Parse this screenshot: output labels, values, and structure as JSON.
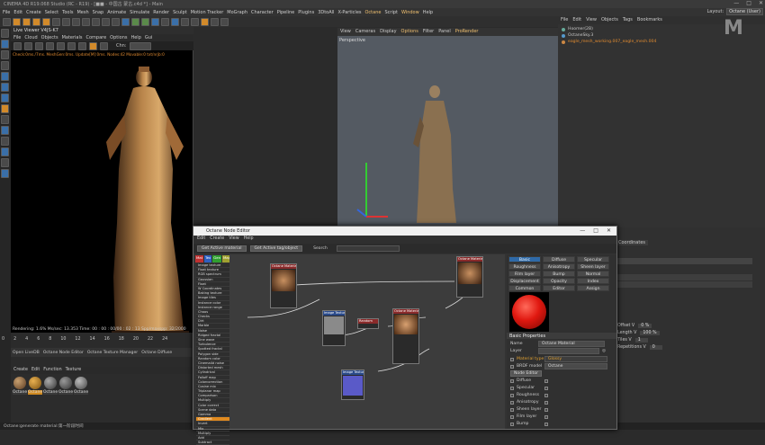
{
  "titlebar": {
    "text": "CINEMA 4D R19.068 Studio (RC - R19) - [■■ - 中国古 蒙古.c4d *] - Main",
    "controls": [
      "—",
      "□",
      "✕"
    ]
  },
  "menubar": [
    "File",
    "Edit",
    "Create",
    "Select",
    "Tools",
    "Mesh",
    "Snap",
    "Animate",
    "Simulate",
    "Render",
    "Sculpt",
    "Motion Tracker",
    "MoGraph",
    "Character",
    "Pipeline",
    "Plugins",
    "3DtoAll",
    "X-Particles",
    "Octane",
    "Script",
    "Window",
    "Help"
  ],
  "layout": {
    "label": "Layout:",
    "value": "Octane (User)"
  },
  "live_viewer": {
    "title": "Live Viewer V4JS-K7",
    "menu": [
      "File",
      "Cloud",
      "Objects",
      "Materials",
      "Compare",
      "Options",
      "Help",
      "Gui"
    ],
    "channel": "Chn:",
    "status": "Check:0ms./7ms. MeshGen:0ms. Update[M]:0ms. Nodes:42 Movable:0 txt/nrjb:0",
    "rendering": "Rendering: 1.6%",
    "ms_sec": "Ms/sec: 13.353",
    "time": "Time: 00 : 00 : 00/00 : 02 : 13",
    "spp": "Spp/maxspp: 32/2000"
  },
  "viewport": {
    "menu": [
      "View",
      "Cameras",
      "Display",
      "Options",
      "Filter",
      "Panel",
      "ProRender"
    ],
    "label": "Perspective"
  },
  "object_manager": {
    "menu": [
      "File",
      "Edit",
      "View",
      "Objects",
      "Tags",
      "Bookmarks"
    ],
    "rows": [
      "Hoomer(2B)",
      "OctaneSky.3",
      "eagle_mesh_working.007_eagle_mesh.004"
    ]
  },
  "timeline": {
    "frames": [
      "0",
      "2",
      "4",
      "6",
      "8",
      "10",
      "12",
      "14",
      "16",
      "18",
      "20",
      "22",
      "24",
      "26"
    ],
    "managers": [
      "Open LiveDB",
      "Octane Node Editor",
      "Octane Texture Manager",
      "Octane Diffuse"
    ]
  },
  "material_manager": {
    "menu": [
      "Create",
      "Edit",
      "Function",
      "Texture"
    ],
    "materials": [
      "Octane",
      "Octane",
      "Octane",
      "Octane",
      "Octane"
    ]
  },
  "attributes": {
    "tab": "Coordinates",
    "fields": [
      {
        "label": "Offset V",
        "value": "0 %"
      },
      {
        "label": "Length V",
        "value": "100 %"
      },
      {
        "label": "Tiles V",
        "value": "1"
      },
      {
        "label": "Repetitions V",
        "value": "0"
      }
    ]
  },
  "node_editor": {
    "title": "Octane Node Editor",
    "controls": [
      "—",
      "□",
      "✕"
    ],
    "menu": [
      "Edit",
      "Create",
      "View",
      "Help"
    ],
    "buttons": [
      "Get Active material",
      "Get Active tag/object"
    ],
    "search_label": "Search",
    "categories": [
      "Mat",
      "Tex",
      "Gen",
      "Map",
      "Om",
      "Env",
      "Pro",
      "C4D"
    ],
    "category_colors": [
      "#c03030",
      "#3060c0",
      "#30a030",
      "#a0a030",
      "#8030a0",
      "#3090a0",
      "#606060",
      "#c06020"
    ],
    "node_list": [
      "Image texture",
      "Float texture",
      "RGB spectrum",
      "Gaussian",
      "Float",
      "W Coordinates",
      "Baking texture",
      "Image tiles",
      "Instance color",
      "Instance range",
      "Chaos",
      "Checks",
      "Dirt",
      "Marble",
      "Noise",
      "Ridged fractal",
      "Sine wave",
      "Turbulence",
      "Spotted fractal",
      "Polygon side",
      "Random color",
      "Cinema4d noise",
      "Distorted mesh",
      "Cylindrical",
      "Falloff map",
      "Colorcorrection",
      "Cosine mix",
      "Triplanar map",
      "Comparison",
      "Multiply",
      "Color correct",
      "Scene data",
      "Gamma",
      "Gradient",
      "Invert",
      "Mix",
      "Multiply",
      "Add",
      "Subtract"
    ],
    "selected_index": 33,
    "props": {
      "tabs": [
        "Basic",
        "Diffuse",
        "Specular",
        "Roughness",
        "Anisotropy",
        "Sheen layer",
        "Film layer",
        "Bump",
        "Normal",
        "Displacement",
        "Opacity",
        "Index",
        "Common",
        "Editor",
        "Assign"
      ],
      "active_tab": "Basic",
      "section": "Basic Properties",
      "name_label": "Name",
      "name_value": "Octane Material",
      "layer_label": "Layer",
      "material_type_label": "Material type",
      "material_type": "Glossy",
      "brdf_label": "BRDF model",
      "brdf": "Octane",
      "node_editor_button": "Node Editor",
      "channels": [
        "Diffuse",
        "Specular",
        "Roughness",
        "Anisotropy",
        "Sheen layer",
        "Film layer",
        "Bump"
      ]
    },
    "nodes": [
      "Octane Material",
      "Image Texture",
      "Random",
      "Octane Material",
      "Octane Material",
      "Image Texture"
    ]
  },
  "statusbar": "Octane:generate material:第一阶段时间"
}
